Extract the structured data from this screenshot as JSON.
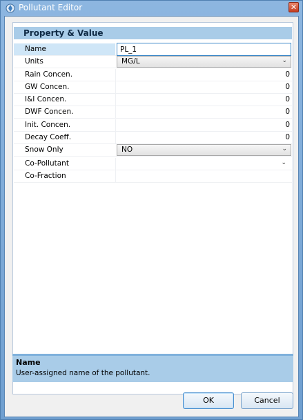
{
  "window": {
    "title": "Pollutant Editor",
    "close_glyph": "✕"
  },
  "grid": {
    "header": "Property  &  Value",
    "rows": [
      {
        "label": "Name",
        "value": "PL_1"
      },
      {
        "label": "Units",
        "value": "MG/L"
      },
      {
        "label": "Rain Concen.",
        "value": "0"
      },
      {
        "label": "GW Concen.",
        "value": "0"
      },
      {
        "label": "I&I Concen.",
        "value": "0"
      },
      {
        "label": "DWF Concen.",
        "value": "0"
      },
      {
        "label": "Init. Concen.",
        "value": "0"
      },
      {
        "label": "Decay Coeff.",
        "value": "0"
      },
      {
        "label": "Snow Only",
        "value": "NO"
      },
      {
        "label": "Co-Pollutant",
        "value": ""
      },
      {
        "label": "Co-Fraction",
        "value": ""
      }
    ]
  },
  "help": {
    "title": "Name",
    "text": "User-assigned name of the pollutant."
  },
  "buttons": {
    "ok": "OK",
    "cancel": "Cancel"
  },
  "icons": {
    "combo_arrow": "chevron-down-icon",
    "app": "pollutant-editor-icon",
    "close": "close-icon"
  }
}
